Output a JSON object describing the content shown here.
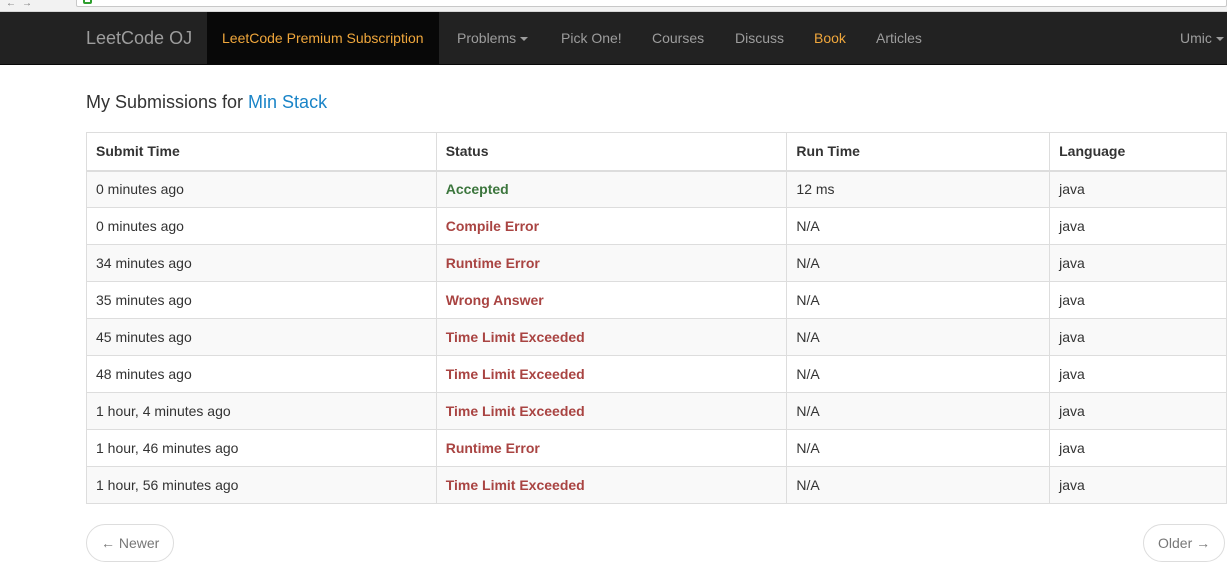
{
  "navbar": {
    "brand": "LeetCode OJ",
    "items": [
      {
        "label": "LeetCode Premium Subscription"
      },
      {
        "label": "Problems"
      },
      {
        "label": "Pick One!"
      },
      {
        "label": "Courses"
      },
      {
        "label": "Discuss"
      },
      {
        "label": "Book"
      },
      {
        "label": "Articles"
      }
    ],
    "user": "Umic",
    "accent_color": "#f0a73c"
  },
  "page": {
    "heading_prefix": "My Submissions for ",
    "problem_link": "Min Stack"
  },
  "table": {
    "headers": [
      "Submit Time",
      "Status",
      "Run Time",
      "Language"
    ],
    "rows": [
      {
        "time": "0 minutes ago",
        "status": "Accepted",
        "runtime": "12 ms",
        "language": "java"
      },
      {
        "time": "0 minutes ago",
        "status": "Compile Error",
        "runtime": "N/A",
        "language": "java"
      },
      {
        "time": "34 minutes ago",
        "status": "Runtime Error",
        "runtime": "N/A",
        "language": "java"
      },
      {
        "time": "35 minutes ago",
        "status": "Wrong Answer",
        "runtime": "N/A",
        "language": "java"
      },
      {
        "time": "45 minutes ago",
        "status": "Time Limit Exceeded",
        "runtime": "N/A",
        "language": "java"
      },
      {
        "time": "48 minutes ago",
        "status": "Time Limit Exceeded",
        "runtime": "N/A",
        "language": "java"
      },
      {
        "time": "1 hour, 4 minutes ago",
        "status": "Time Limit Exceeded",
        "runtime": "N/A",
        "language": "java"
      },
      {
        "time": "1 hour, 46 minutes ago",
        "status": "Runtime Error",
        "runtime": "N/A",
        "language": "java"
      },
      {
        "time": "1 hour, 56 minutes ago",
        "status": "Time Limit Exceeded",
        "runtime": "N/A",
        "language": "java"
      }
    ],
    "status_colors": {
      "accepted": "#3c763d",
      "error": "#a94442"
    }
  },
  "pager": {
    "newer": "← Newer",
    "older": "Older →"
  }
}
